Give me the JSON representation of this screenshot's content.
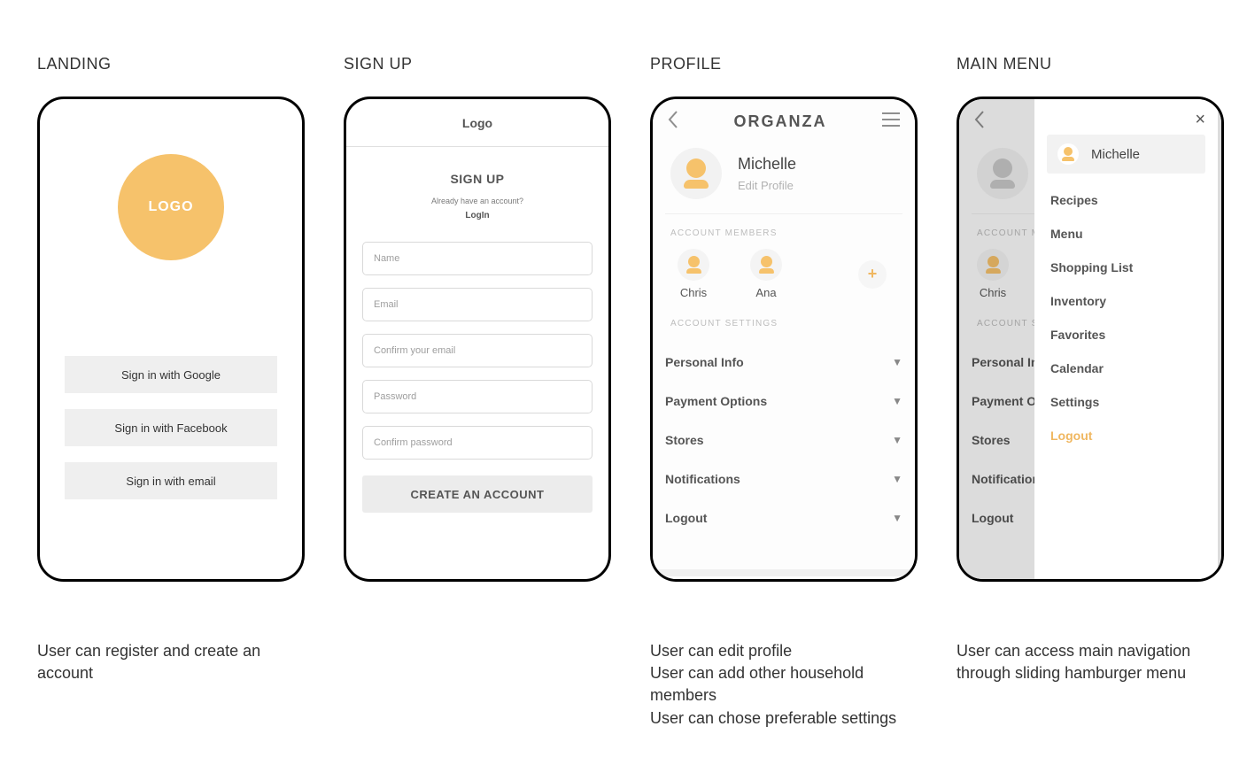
{
  "landing": {
    "title": "LANDING",
    "logo_text": "LOGO",
    "btn_google": "Sign in with Google",
    "btn_facebook": "Sign in with Facebook",
    "btn_email": "Sign in with email",
    "caption": "User can register and create an account"
  },
  "signup": {
    "title": "SIGN UP",
    "top_label": "Logo",
    "heading": "SIGN UP",
    "already": "Already have an account?",
    "login_label": "LogIn",
    "ph_name": "Name",
    "ph_email": "Email",
    "ph_confirm_email": "Confirm your email",
    "ph_password": "Password",
    "ph_confirm_password": "Confirm password",
    "cta": "CREATE AN ACCOUNT"
  },
  "profile": {
    "title": "PROFILE",
    "app_name": "ORGANZA",
    "user_name": "Michelle",
    "edit_label": "Edit Profile",
    "members_section": "ACCOUNT MEMBERS",
    "members": [
      {
        "name": "Chris"
      },
      {
        "name": "Ana"
      }
    ],
    "add_symbol": "+",
    "settings_section": "ACCOUNT SETTINGS",
    "settings": [
      "Personal Info",
      "Payment Options",
      "Stores",
      "Notifications",
      "Logout"
    ],
    "caption1": "User can edit profile",
    "caption2": "User can add other household members",
    "caption3": "User can chose preferable settings"
  },
  "mainmenu": {
    "title": "MAIN MENU",
    "bg_member_name": "Chris",
    "bg_settings_section": "ACCOUNT SETTINGS",
    "bg_settings": [
      "Personal Info",
      "Payment Options",
      "Stores",
      "Notifications",
      "Logout"
    ],
    "user_name": "Michelle",
    "items": [
      "Recipes",
      "Menu",
      "Shopping List",
      "Inventory",
      "Favorites",
      "Calendar",
      "Settings"
    ],
    "logout": "Logout",
    "close": "×",
    "caption": "User can access main navigation through sliding hamburger menu"
  }
}
